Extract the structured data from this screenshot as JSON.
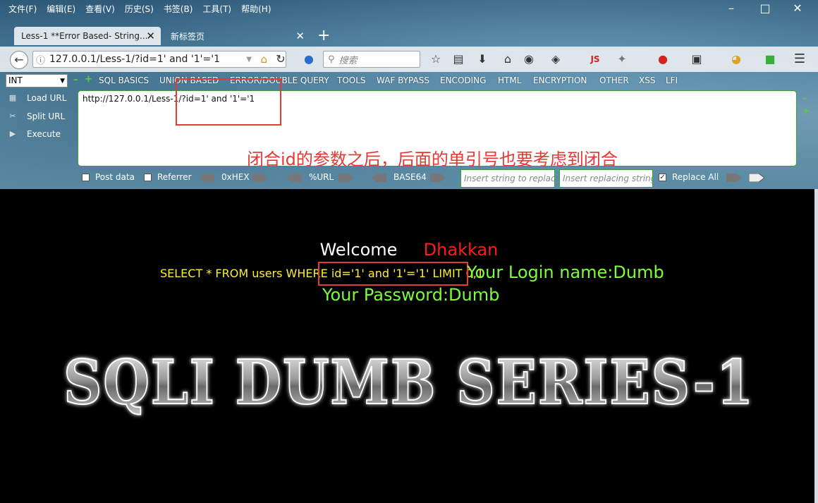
{
  "menubar": {
    "items": [
      "文件(F)",
      "编辑(E)",
      "查看(V)",
      "历史(S)",
      "书签(B)",
      "工具(T)",
      "帮助(H)"
    ]
  },
  "tabs": [
    {
      "label": "Less-1 **Error Based- String...",
      "active": true
    },
    {
      "label": "新标签页",
      "active": false
    }
  ],
  "navbar": {
    "url": "127.0.0.1/Less-1/?id=1'  and '1'='1",
    "search_placeholder": "搜索",
    "js_label": "JS"
  },
  "hackbar": {
    "type_select": "INT",
    "menus": [
      "SQL BASICS",
      "UNION BASED",
      "ERROR/DOUBLE QUERY",
      "TOOLS",
      "WAF BYPASS",
      "ENCODING",
      "HTML",
      "ENCRYPTION",
      "OTHER",
      "XSS",
      "LFI"
    ],
    "buttons": {
      "load": "Load URL",
      "split": "Split URL",
      "execute": "Execute"
    },
    "url_text": "http://127.0.0.1/Less-1/?id=1'  and '1'='1",
    "annotation": "闭合id的参数之后，后面的单引号也要考虑到闭合",
    "post_data": "Post data",
    "referrer": "Referrer",
    "hex": "0xHEX",
    "url_enc": "%URL",
    "base64": "BASE64",
    "insert_placeholder": "Insert string to replace",
    "replace_placeholder": "Insert replacing string",
    "replace_all": "Replace All"
  },
  "page": {
    "welcome": "Welcome",
    "user": "Dhakkan",
    "query_prefix": "SELECT * FROM users WHERE ",
    "query_highlight": "id='1' and '1'='1' LIMIT 0,1",
    "login": "Your Login name:Dumb",
    "password": "Your Password:Dumb",
    "banner": "SQLI DUMB SERIES-1"
  },
  "colors": {
    "annotation_red": "#e53935",
    "query_yellow": "#ffee33",
    "result_green": "#7cfc3c",
    "user_red": "#ff1a1a"
  }
}
